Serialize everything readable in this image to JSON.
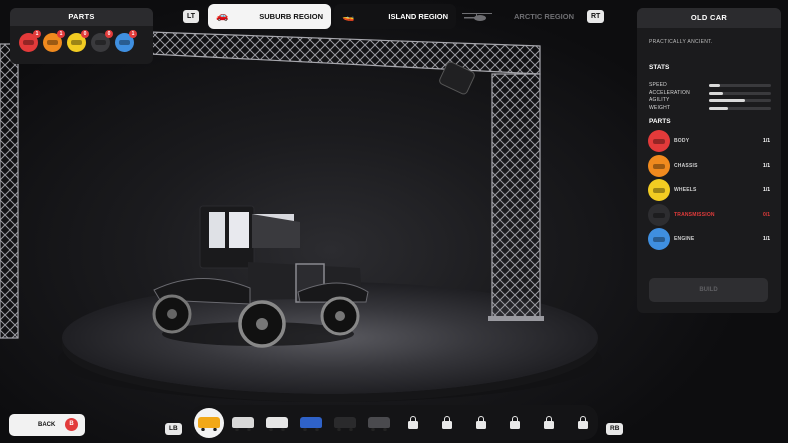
{
  "parts_panel": {
    "title": "PARTS",
    "icons": [
      {
        "name": "body-part-icon",
        "color": "#e33a3a",
        "badge": "1"
      },
      {
        "name": "chassis-part-icon",
        "color": "#f08a1e",
        "badge": "1"
      },
      {
        "name": "wheels-part-icon",
        "color": "#f2cc22",
        "badge": "0"
      },
      {
        "name": "transmission-part-icon",
        "color": "#3a3a3d",
        "badge": "0"
      },
      {
        "name": "engine-part-icon",
        "color": "#3f8fe0",
        "badge": "1"
      }
    ]
  },
  "region_bar": {
    "lt": "LT",
    "rt": "RT",
    "tabs": [
      {
        "label": "SUBURB REGION",
        "icon": "car-icon",
        "state": "active"
      },
      {
        "label": "ISLAND REGION",
        "icon": "boat-icon",
        "state": "available"
      },
      {
        "label": "ARCTIC REGION",
        "icon": "helicopter-icon",
        "state": "locked"
      }
    ]
  },
  "info_panel": {
    "title": "OLD CAR",
    "description": "PRACTICALLY ANCIENT.",
    "stats_title": "STATS",
    "stats": [
      {
        "label": "SPEED",
        "value": 0.18
      },
      {
        "label": "ACCELERATION",
        "value": 0.22
      },
      {
        "label": "AGILITY",
        "value": 0.58
      },
      {
        "label": "WEIGHT",
        "value": 0.3
      }
    ],
    "parts_title": "PARTS",
    "parts": [
      {
        "label": "BODY",
        "count": "1/1",
        "color": "#e33a3a",
        "icon": "body-part-icon",
        "missing": false
      },
      {
        "label": "CHASSIS",
        "count": "1/1",
        "color": "#f08a1e",
        "icon": "chassis-part-icon",
        "missing": false
      },
      {
        "label": "WHEELS",
        "count": "1/1",
        "color": "#f2cc22",
        "icon": "wheels-part-icon",
        "missing": false
      },
      {
        "label": "TRANSMISSION",
        "count": "0/1",
        "color": "#2d2d30",
        "icon": "transmission-part-icon",
        "missing": true
      },
      {
        "label": "ENGINE",
        "count": "1/1",
        "color": "#3f8fe0",
        "icon": "engine-part-icon",
        "missing": false
      }
    ],
    "build_label": "BUILD"
  },
  "bottom": {
    "back_label": "BACK",
    "back_key": "B",
    "lb": "LB",
    "rb": "RB",
    "vehicles": [
      {
        "type": "car",
        "color": "#f2a818",
        "selected": true
      },
      {
        "type": "car",
        "color": "#d8d8d8",
        "selected": false
      },
      {
        "type": "car",
        "color": "#e6e6e6",
        "selected": false
      },
      {
        "type": "car",
        "color": "#2f62c8",
        "selected": false
      },
      {
        "type": "car",
        "color": "#2a2a2c",
        "selected": false
      },
      {
        "type": "car",
        "color": "#4a4a4e",
        "selected": false
      },
      {
        "type": "locked"
      },
      {
        "type": "locked"
      },
      {
        "type": "locked"
      },
      {
        "type": "locked"
      },
      {
        "type": "locked"
      },
      {
        "type": "locked"
      }
    ]
  },
  "colors": {
    "accent_red": "#e23b3b",
    "panel_bg": "#1b1b1d",
    "panel_header": "#2b2b2e",
    "missing_text": "#e23b3b"
  }
}
